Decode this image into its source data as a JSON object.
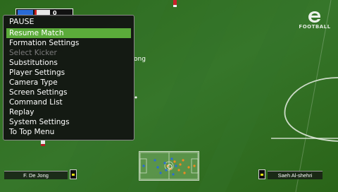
{
  "scoreboard": {
    "away_score": "0",
    "home_color": "#2a6bd6",
    "away_color": "#e8e8e8",
    "away_accent": "#c82020"
  },
  "logo": {
    "text": "FOOTBALL",
    "icon": "efootball-logo"
  },
  "pause_menu": {
    "title": "PAUSE",
    "items": [
      {
        "label": "Resume Match",
        "state": "selected"
      },
      {
        "label": "Formation Settings",
        "state": "normal"
      },
      {
        "label": "Select Kicker",
        "state": "disabled"
      },
      {
        "label": "Substitutions",
        "state": "normal"
      },
      {
        "label": "Player Settings",
        "state": "normal"
      },
      {
        "label": "Camera Type",
        "state": "normal"
      },
      {
        "label": "Screen Settings",
        "state": "normal"
      },
      {
        "label": "Command List",
        "state": "normal"
      },
      {
        "label": "Replay",
        "state": "normal"
      },
      {
        "label": "System Settings",
        "state": "normal"
      },
      {
        "label": "To Top Menu",
        "state": "normal"
      }
    ],
    "selected_color": "#5bab3a"
  },
  "background_text": "ong",
  "player_left": {
    "name": "F. De Jong"
  },
  "player_right": {
    "name": "Saeh Al-shehri"
  },
  "colors": {
    "pitch_dark": "#2b6219",
    "pitch_light": "#357523",
    "stamina": "#e6e20e"
  }
}
